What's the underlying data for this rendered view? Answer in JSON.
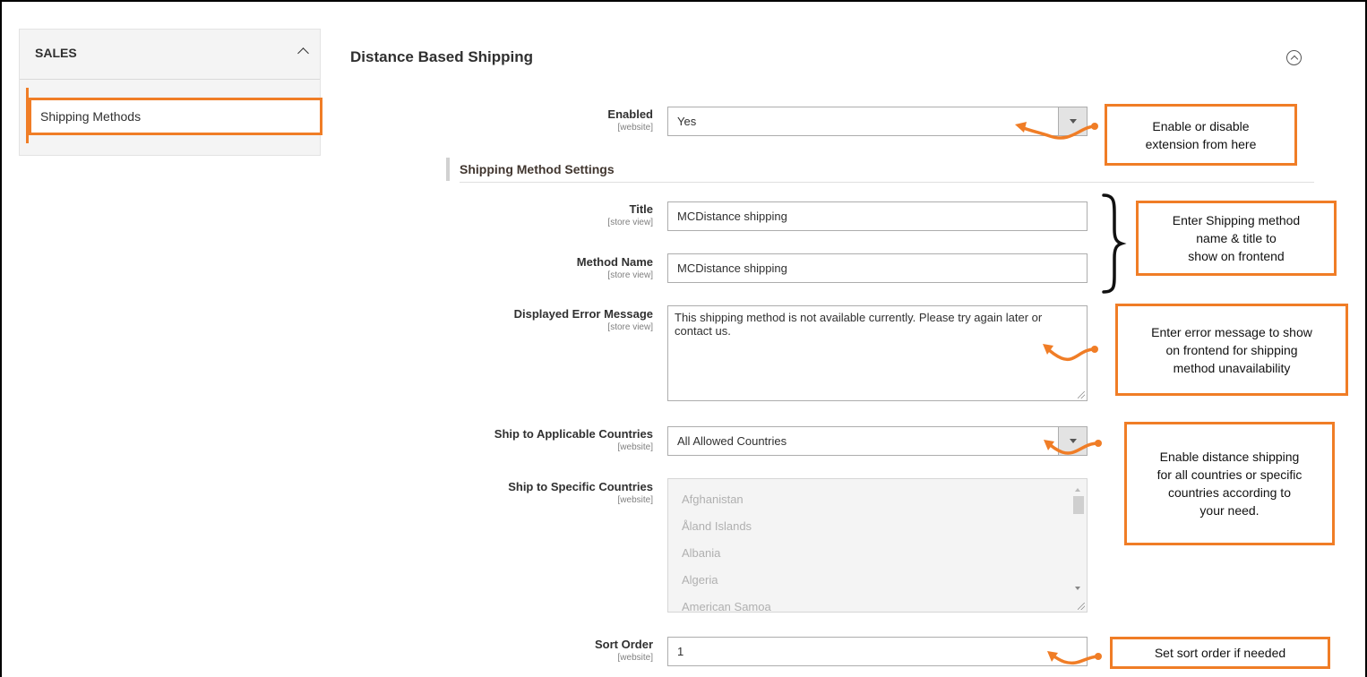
{
  "sidebar": {
    "title": "SALES",
    "items": [
      {
        "label": "Shipping Methods"
      }
    ]
  },
  "section": {
    "title": "Distance Based Shipping"
  },
  "fields": {
    "enabled": {
      "label": "Enabled",
      "scope": "[website]",
      "value": "Yes"
    },
    "group_title": "Shipping Method Settings",
    "title": {
      "label": "Title",
      "scope": "[store view]",
      "value": "MCDistance shipping"
    },
    "method_name": {
      "label": "Method Name",
      "scope": "[store view]",
      "value": "MCDistance shipping"
    },
    "error_message": {
      "label": "Displayed Error Message",
      "scope": "[store view]",
      "value": "This shipping method is not available currently. Please try again later or contact us."
    },
    "applicable_countries": {
      "label": "Ship to Applicable Countries",
      "scope": "[website]",
      "value": "All Allowed Countries"
    },
    "specific_countries": {
      "label": "Ship to Specific Countries",
      "scope": "[website]",
      "options": [
        "Afghanistan",
        "Åland Islands",
        "Albania",
        "Algeria",
        "American Samoa"
      ]
    },
    "sort_order": {
      "label": "Sort Order",
      "scope": "[website]",
      "value": "1"
    }
  },
  "callouts": {
    "enable": {
      "lines": [
        "Enable or disable",
        "extension from here"
      ]
    },
    "name_title": {
      "lines": [
        "Enter Shipping method",
        "name & title to",
        "show on frontend"
      ]
    },
    "error": {
      "lines": [
        "Enter error message to show",
        "on frontend for shipping",
        "method unavailability"
      ]
    },
    "countries": {
      "lines": [
        "Enable distance shipping",
        "for all countries or specific",
        "countries according to",
        "your need."
      ]
    },
    "sort": {
      "lines": [
        "Set sort order if needed"
      ]
    }
  },
  "colors": {
    "accent": "#f07d26",
    "frame": "#000000"
  },
  "icons": {
    "sidebar_toggle": "chevron-up-icon",
    "section_toggle": "collapse-circle-icon",
    "select_arrow": "dropdown-arrow-icon",
    "annotation_arrow": "curved-arrow-icon",
    "annotation_brace": "curly-brace-icon"
  }
}
